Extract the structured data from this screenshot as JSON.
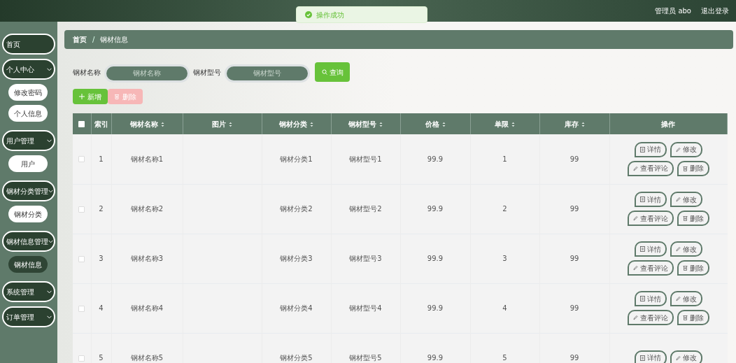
{
  "header": {
    "user": "管理员 abo",
    "logout": "退出登录"
  },
  "toast": {
    "text": "操作成功"
  },
  "sidebar": [
    {
      "label": "首页",
      "expandable": false
    },
    {
      "label": "个人中心",
      "expandable": true,
      "children": [
        {
          "label": "修改密码",
          "selected": false
        },
        {
          "label": "个人信息",
          "selected": false
        }
      ]
    },
    {
      "label": "用户管理",
      "expandable": true,
      "children": [
        {
          "label": "用户",
          "selected": false
        }
      ]
    },
    {
      "label": "钢材分类管理",
      "expandable": true,
      "children": [
        {
          "label": "钢材分类",
          "selected": false
        }
      ]
    },
    {
      "label": "钢材信息管理",
      "expandable": true,
      "children": [
        {
          "label": "钢材信息",
          "selected": true
        }
      ]
    },
    {
      "label": "系统管理",
      "expandable": true
    },
    {
      "label": "订单管理",
      "expandable": true
    }
  ],
  "breadcrumb": [
    "首页",
    "钢材信息"
  ],
  "breadcrumb_separator": "/",
  "search": [
    {
      "label": "钢材名称",
      "placeholder": "钢材名称"
    },
    {
      "label": "钢材型号",
      "placeholder": "钢材型号"
    }
  ],
  "search_button": "查询",
  "actions": [
    {
      "label": "新增",
      "kind": "add"
    },
    {
      "label": "删除",
      "kind": "delete"
    }
  ],
  "table": {
    "select_all_checked": false,
    "columns": [
      {
        "label": "索引",
        "sortable": false
      },
      {
        "label": "钢材名称",
        "sortable": true
      },
      {
        "label": "图片",
        "sortable": true
      },
      {
        "label": "钢材分类",
        "sortable": true
      },
      {
        "label": "钢材型号",
        "sortable": true
      },
      {
        "label": "价格",
        "sortable": true
      },
      {
        "label": "单限",
        "sortable": true
      },
      {
        "label": "库存",
        "sortable": true
      },
      {
        "label": "操作",
        "sortable": false
      }
    ],
    "rows": [
      {
        "checked": false,
        "cells": [
          "1",
          "钢材名称1",
          "",
          "钢材分类1",
          "钢材型号1",
          "99.9",
          "1",
          "99"
        ],
        "actions": [
          {
            "label": "详情",
            "kind": "detail"
          },
          {
            "label": "修改",
            "kind": "edit"
          },
          {
            "label": "查看评论",
            "kind": "edit"
          },
          {
            "label": "删除",
            "kind": "delete"
          }
        ]
      },
      {
        "checked": false,
        "cells": [
          "2",
          "钢材名称2",
          "",
          "钢材分类2",
          "钢材型号2",
          "99.9",
          "2",
          "99"
        ],
        "actions": [
          {
            "label": "详情",
            "kind": "detail"
          },
          {
            "label": "修改",
            "kind": "edit"
          },
          {
            "label": "查看评论",
            "kind": "edit"
          },
          {
            "label": "删除",
            "kind": "delete"
          }
        ]
      },
      {
        "checked": false,
        "cells": [
          "3",
          "钢材名称3",
          "",
          "钢材分类3",
          "钢材型号3",
          "99.9",
          "3",
          "99"
        ],
        "actions": [
          {
            "label": "详情",
            "kind": "detail"
          },
          {
            "label": "修改",
            "kind": "edit"
          },
          {
            "label": "查看评论",
            "kind": "edit"
          },
          {
            "label": "删除",
            "kind": "delete"
          }
        ]
      },
      {
        "checked": false,
        "cells": [
          "4",
          "钢材名称4",
          "",
          "钢材分类4",
          "钢材型号4",
          "99.9",
          "4",
          "99"
        ],
        "actions": [
          {
            "label": "详情",
            "kind": "detail"
          },
          {
            "label": "修改",
            "kind": "edit"
          },
          {
            "label": "查看评论",
            "kind": "edit"
          },
          {
            "label": "删除",
            "kind": "delete"
          }
        ]
      },
      {
        "checked": false,
        "cells": [
          "5",
          "钢材名称5",
          "",
          "钢材分类5",
          "钢材型号5",
          "99.9",
          "5",
          "99"
        ],
        "actions": [
          {
            "label": "详情",
            "kind": "detail"
          },
          {
            "label": "修改",
            "kind": "edit"
          }
        ]
      }
    ]
  }
}
